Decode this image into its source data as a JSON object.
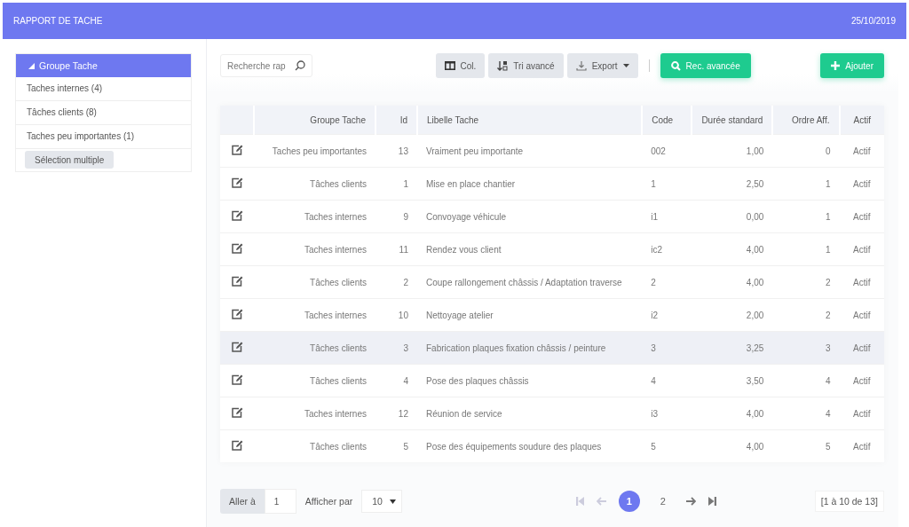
{
  "header": {
    "title": "RAPPORT DE TACHE",
    "date": "25/10/2019"
  },
  "sidebar": {
    "group": {
      "label": "Groupe Tache",
      "expanded": true
    },
    "items": [
      {
        "label": "Taches internes (4)",
        "selected": false
      },
      {
        "label": "Tâches clients (8)",
        "selected": false
      },
      {
        "label": "Taches peu importantes (1)",
        "selected": false
      }
    ],
    "button": "Sélection multiple"
  },
  "toolbar": {
    "search": {
      "placeholder": "Recherche rap"
    },
    "buttons": [
      {
        "label": "Col.",
        "kind": "columns"
      },
      {
        "label": "Tri avancé",
        "kind": "sort"
      },
      {
        "label": "Export",
        "kind": "download"
      },
      {
        "label": "Rec. avancée",
        "kind": "search"
      }
    ],
    "add_button": {
      "label": "Ajouter",
      "kind": "plus"
    }
  },
  "table": {
    "columns": [
      "Groupe Tache",
      "Id",
      "Libelle Tache",
      "Code",
      "Durée standard",
      "Ordre Aff.",
      "Actif"
    ],
    "rows": [
      {
        "selected": false,
        "cells": [
          "Taches peu importantes",
          "13",
          "Vraiment peu importante",
          "002",
          "1,00",
          "0",
          "Actif"
        ]
      },
      {
        "selected": false,
        "cells": [
          "Tâches clients",
          "1",
          "Mise en place chantier",
          "1",
          "2,50",
          "1",
          "Actif"
        ]
      },
      {
        "selected": false,
        "cells": [
          "Taches internes",
          "9",
          "Convoyage véhicule",
          "i1",
          "0,00",
          "1",
          "Actif"
        ]
      },
      {
        "selected": false,
        "cells": [
          "Taches internes",
          "11",
          "Rendez vous client",
          "ic2",
          "4,00",
          "1",
          "Actif"
        ]
      },
      {
        "selected": false,
        "cells": [
          "Tâches clients",
          "2",
          "Coupe rallongement châssis / Adaptation traverse",
          "2",
          "4,00",
          "2",
          "Actif"
        ]
      },
      {
        "selected": false,
        "cells": [
          "Taches internes",
          "10",
          "Nettoyage atelier",
          "i2",
          "2,00",
          "2",
          "Actif"
        ]
      },
      {
        "selected": true,
        "cells": [
          "Tâches clients",
          "3",
          "Fabrication plaques fixation châssis / peinture",
          "3",
          "3,25",
          "3",
          "Actif"
        ]
      },
      {
        "selected": false,
        "cells": [
          "Tâches clients",
          "4",
          "Pose des plaques châssis",
          "4",
          "3,50",
          "4",
          "Actif"
        ]
      },
      {
        "selected": false,
        "cells": [
          "Taches internes",
          "12",
          "Réunion de service",
          "i3",
          "4,00",
          "4",
          "Actif"
        ]
      },
      {
        "selected": false,
        "cells": [
          "Tâches clients",
          "5",
          "Pose des équipements soudure des plaques",
          "5",
          "4,00",
          "5",
          "Actif"
        ]
      }
    ]
  },
  "footer": {
    "goto_label": "Aller à",
    "goto_value": "1",
    "per_page_label": "Afficher par",
    "per_page_value": "10",
    "nav": {
      "first_disabled": true,
      "prev_disabled": true,
      "next_disabled": false,
      "last_disabled": false
    },
    "pages": [
      {
        "label": "1",
        "selected": true
      },
      {
        "label": "2",
        "selected": false
      }
    ],
    "range": "[1 à 10 de 13]"
  }
}
